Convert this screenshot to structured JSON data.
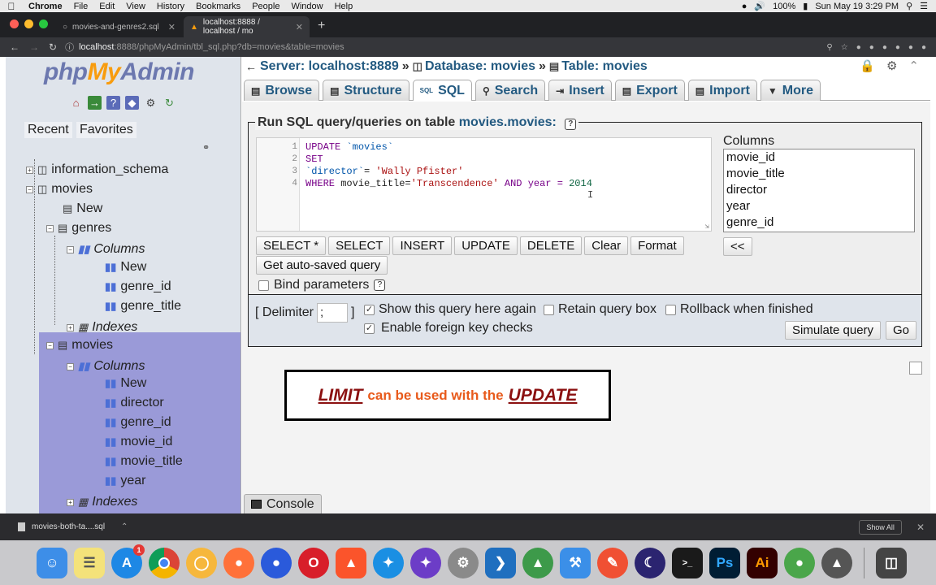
{
  "menubar": {
    "app": "Chrome",
    "items": [
      "File",
      "Edit",
      "View",
      "History",
      "Bookmarks",
      "People",
      "Window",
      "Help"
    ],
    "battery": "100%",
    "datetime": "Sun May 19  3:29 PM"
  },
  "browser": {
    "tabs": [
      {
        "title": "movies-and-genres2.sql"
      },
      {
        "title": "localhost:8888 / localhost / mo"
      }
    ],
    "url_host": "localhost",
    "url_rest": ":8888/phpMyAdmin/tbl_sql.php?db=movies&table=movies"
  },
  "sidebar": {
    "logo_php": "php",
    "logo_my": "My",
    "logo_admin": "Admin",
    "tab_recent": "Recent",
    "tab_favorites": "Favorites",
    "tree": {
      "information_schema": "information_schema",
      "movies_db": "movies",
      "new_table": "New",
      "genres": "genres",
      "genres_columns": "Columns",
      "genres_new": "New",
      "genre_id": "genre_id",
      "genre_title": "genre_title",
      "genres_indexes": "Indexes",
      "movies_table": "movies",
      "movies_columns": "Columns",
      "movies_new": "New",
      "col_director": "director",
      "col_genre_id": "genre_id",
      "col_movie_id": "movie_id",
      "col_movie_title": "movie_title",
      "col_year": "year",
      "movies_indexes": "Indexes"
    }
  },
  "breadcrumb": {
    "server": "Server: localhost:8889",
    "database": "Database: movies",
    "table": "Table: movies"
  },
  "tabs": {
    "browse": "Browse",
    "structure": "Structure",
    "sql": "SQL",
    "search": "Search",
    "insert": "Insert",
    "export": "Export",
    "import": "Import",
    "more": "More"
  },
  "query": {
    "legend_prefix": "Run SQL query/queries on table",
    "legend_table": "movies.movies:",
    "line_numbers": [
      "1",
      "2",
      "3",
      "4"
    ],
    "line1_kw": "UPDATE",
    "line1_ident": " `movies`",
    "line2_kw": "SET",
    "line3_ident": "`director`",
    "line3_eq": "= ",
    "line3_str": "'Wally Pfister'",
    "line4_kw": "WHERE",
    "line4_a": " movie_title=",
    "line4_str": "'Transcendence'",
    "line4_and": " AND ",
    "line4_b": "year = ",
    "line4_num": "2014",
    "buttons": {
      "select_star": "SELECT *",
      "select": "SELECT",
      "insert": "INSERT",
      "update": "UPDATE",
      "delete": "DELETE",
      "clear": "Clear",
      "format": "Format"
    },
    "autosave": "Get auto-saved query",
    "bind_parameters": "Bind parameters",
    "columns_label": "Columns",
    "columns": [
      "movie_id",
      "movie_title",
      "director",
      "year",
      "genre_id"
    ],
    "insert_cols": "<<"
  },
  "options": {
    "delimiter_label": "[ Delimiter",
    "delimiter_value": ";",
    "delimiter_close": "]",
    "show_query": "Show this query here again",
    "retain_box": "Retain query box",
    "rollback": "Rollback when finished",
    "fk_checks": "Enable foreign key checks",
    "simulate": "Simulate query",
    "go": "Go"
  },
  "annotation": {
    "word1": "LIMIT",
    "middle": "can be used with the",
    "word2": "UPDATE"
  },
  "console": "Console",
  "download": {
    "file": "movies-both-ta....sql",
    "show_all": "Show All"
  },
  "dock": {
    "appstore_badge": "1"
  }
}
